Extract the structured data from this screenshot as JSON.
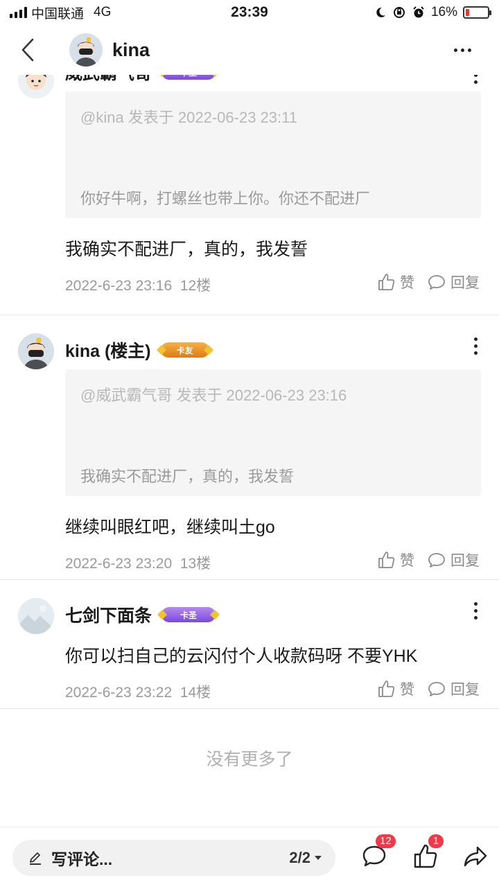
{
  "status_bar": {
    "carrier": "中国联通",
    "network": "4G",
    "time": "23:39",
    "battery": "16%",
    "battery_level": 0.16
  },
  "header": {
    "title": "kina"
  },
  "posts": [
    {
      "username": "威武霸气哥",
      "badge": "卡圣",
      "quote_head": "@kina 发表于 2022-06-23 23:11",
      "quote_body": "你好牛啊，打螺丝也带上你。你还不配进厂",
      "content": "我确实不配进厂，真的，我发誓",
      "timestamp": "2022-6-23 23:16",
      "floor": "12楼",
      "like_label": "赞",
      "reply_label": "回复"
    },
    {
      "username": "kina (楼主)",
      "badge": "卡友",
      "quote_head": "@威武霸气哥 发表于 2022-06-23 23:16",
      "quote_body": "我确实不配进厂，真的，我发誓",
      "content": "继续叫眼红吧，继续叫土go",
      "timestamp": "2022-6-23 23:20",
      "floor": "13楼",
      "like_label": "赞",
      "reply_label": "回复"
    },
    {
      "username": "七剑下面条",
      "badge": "卡圣",
      "content": "你可以扫自己的云闪付个人收款码呀  不要YHK",
      "timestamp": "2022-6-23 23:22",
      "floor": "14楼",
      "like_label": "赞",
      "reply_label": "回复"
    }
  ],
  "footer_note": "没有更多了",
  "bottom_bar": {
    "comment_placeholder": "写评论...",
    "page": "2/2",
    "comment_count": "12",
    "like_count": "1"
  }
}
